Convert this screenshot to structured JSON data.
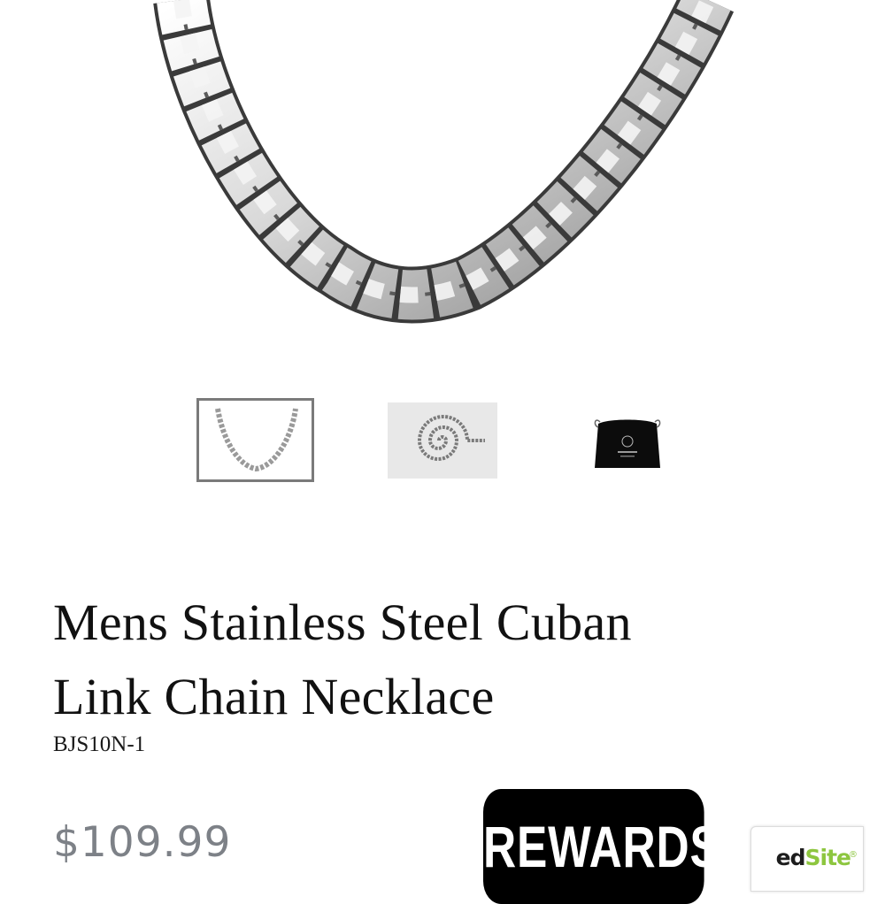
{
  "product": {
    "title_line1": "Mens Stainless Steel Cuban",
    "title_line2": "Link Chain Necklace",
    "sku": "BJS10N-1",
    "price": "$109.99"
  },
  "gallery": {
    "hero_image": "cuban-link-chain-main-image",
    "thumbnails": [
      {
        "image": "chain-front-view",
        "selected": true
      },
      {
        "image": "chain-coiled-view",
        "selected": false
      },
      {
        "image": "black-gift-pouch",
        "selected": false
      }
    ]
  },
  "rewards_button": {
    "label": "REWARDS"
  },
  "trust_badge": {
    "text_visible": "ed",
    "text_accent": "Site",
    "mark": "®"
  },
  "colors": {
    "price": "#7d8187",
    "rewards_bg": "#000000",
    "badge_accent": "#8dc63f",
    "thumb_selected_border": "#7a7a7a"
  }
}
